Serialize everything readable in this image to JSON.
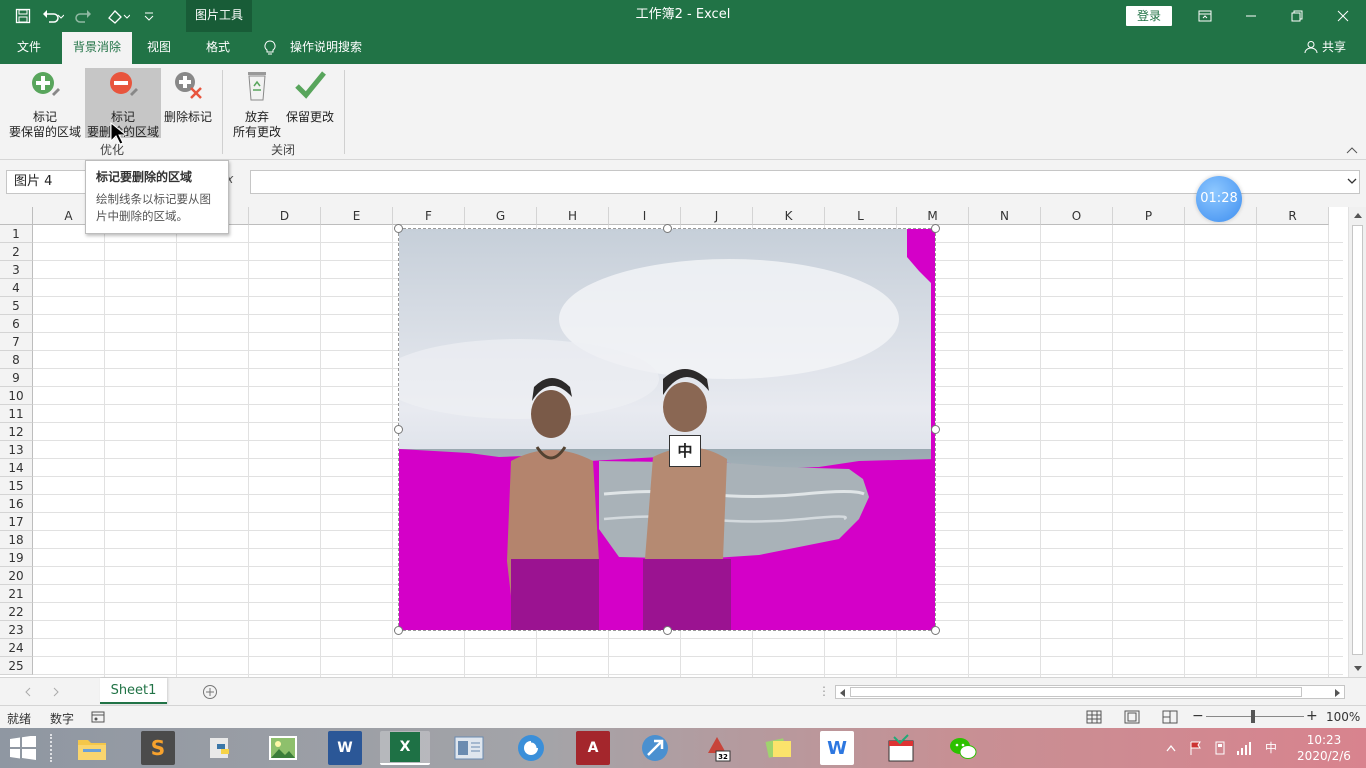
{
  "window": {
    "title": "工作簿2  -  Excel",
    "context_tab": "图片工具",
    "login_label": "登录",
    "controls": [
      "ribbon-display-icon",
      "minimize-icon",
      "restore-icon",
      "close-icon"
    ]
  },
  "quick_access": [
    "save-icon",
    "undo-icon",
    "redo-icon",
    "touch-mode-icon",
    "customize-icon"
  ],
  "tabs": [
    {
      "label": "文件"
    },
    {
      "label": "背景消除",
      "active": true
    },
    {
      "label": "视图"
    },
    {
      "label": "格式"
    },
    {
      "label": "操作说明搜索"
    }
  ],
  "share_label": "共享",
  "ribbon": {
    "optimize": {
      "label": "优化",
      "mark_keep": {
        "line1": "标记",
        "line2": "要保留的区域"
      },
      "mark_remove": {
        "line1": "标记",
        "line2": "要删除的区域"
      },
      "delete_mark": {
        "label": "删除标记"
      }
    },
    "close": {
      "label": "关闭",
      "discard": {
        "line1": "放弃",
        "line2": "所有更改"
      },
      "keep": {
        "label": "保留更改"
      }
    }
  },
  "tooltip": {
    "title": "标记要删除的区域",
    "body_line1": "绘制线条以标记要从图",
    "body_line2": "片中删除的区域。"
  },
  "formula_bar": {
    "name_box": "图片 4",
    "fx_label": "fx",
    "value": ""
  },
  "grid": {
    "columns": [
      "A",
      "B",
      "C",
      "D",
      "E",
      "F",
      "G",
      "H",
      "I",
      "J",
      "K",
      "L",
      "M",
      "N",
      "O",
      "P",
      "Q",
      "R"
    ],
    "rows": [
      "1",
      "2",
      "3",
      "4",
      "5",
      "6",
      "7",
      "8",
      "9",
      "10",
      "11",
      "12",
      "13",
      "14",
      "15",
      "16",
      "17",
      "18",
      "19",
      "20",
      "21",
      "22",
      "23",
      "24",
      "25"
    ]
  },
  "timer": "01:28",
  "picture": {
    "move_glyph": "中",
    "remove_color": "#d400c8"
  },
  "sheets": [
    {
      "label": "Sheet1",
      "active": true
    }
  ],
  "status": {
    "ready": "就绪",
    "numlock": "数字",
    "zoom": "100%"
  },
  "taskbar": {
    "apps": [
      {
        "name": "file-explorer"
      },
      {
        "name": "sublime-text",
        "glyph": "S"
      },
      {
        "name": "python"
      },
      {
        "name": "photo-viewer"
      },
      {
        "name": "word",
        "glyph": "W"
      },
      {
        "name": "excel",
        "glyph": "X",
        "active": true
      },
      {
        "name": "reader"
      },
      {
        "name": "browser"
      },
      {
        "name": "access",
        "glyph": "A"
      },
      {
        "name": "tool-beta"
      },
      {
        "name": "game-32"
      },
      {
        "name": "sticky-notes"
      },
      {
        "name": "wps",
        "glyph": "W"
      },
      {
        "name": "calendar-app"
      },
      {
        "name": "wechat"
      }
    ],
    "ime": "中",
    "time": "10:23",
    "date": "2020/2/6"
  },
  "colors": {
    "excel_green": "#217346",
    "ribbon_bg": "#f3f3f3",
    "remove_magenta": "#d400c8"
  }
}
